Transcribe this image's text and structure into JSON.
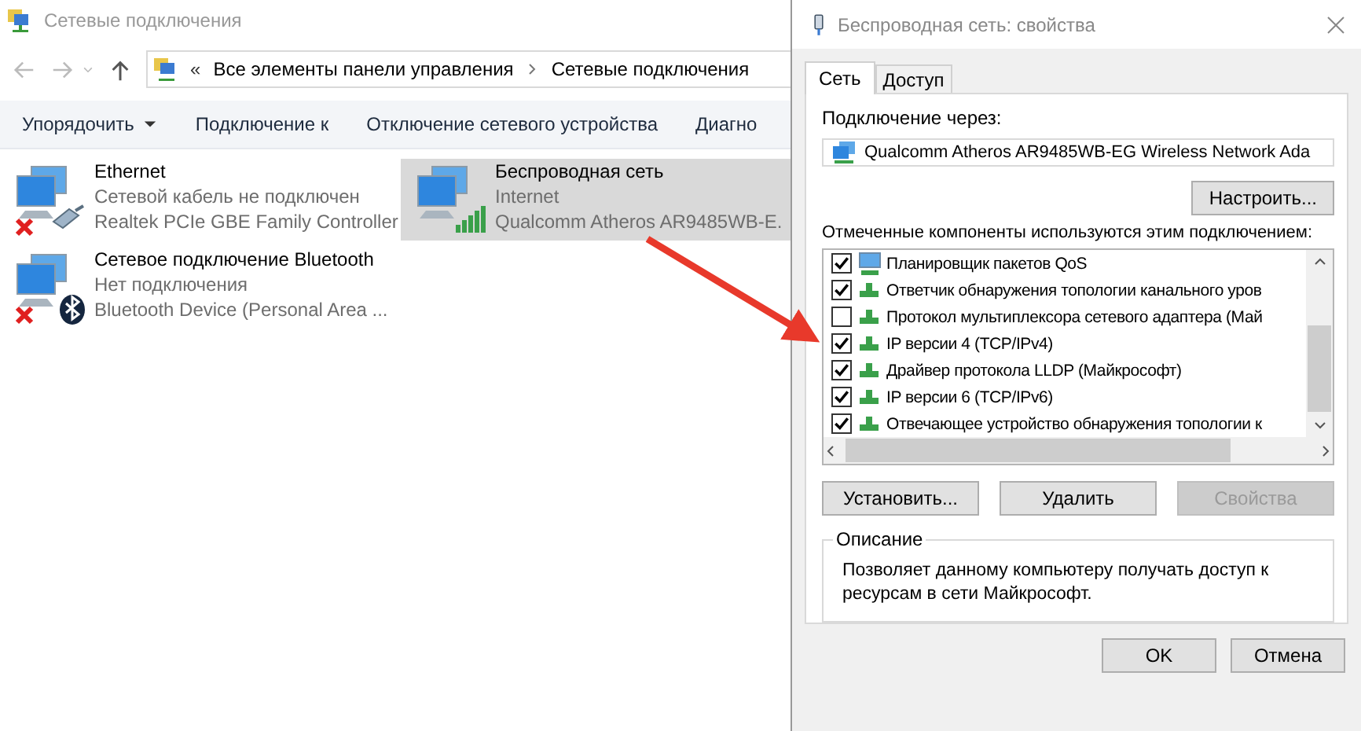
{
  "explorer": {
    "title": "Сетевые подключения",
    "breadcrumb_prefix": "«",
    "breadcrumb": [
      "Все элементы панели управления",
      "Сетевые подключения"
    ],
    "toolbar": [
      {
        "label": "Упорядочить",
        "dropdown": true
      },
      {
        "label": "Подключение к",
        "dropdown": false
      },
      {
        "label": "Отключение сетевого устройства",
        "dropdown": false
      },
      {
        "label": "Диагно",
        "dropdown": false
      }
    ],
    "connections": [
      {
        "kind": "ethernet",
        "name": "Ethernet",
        "status": "Сетевой кабель не подключен",
        "device": "Realtek PCIe GBE Family Controller",
        "disconnected": true,
        "selected": false
      },
      {
        "kind": "wifi",
        "name": "Беспроводная сеть",
        "status": "Internet",
        "device": "Qualcomm Atheros AR9485WB-E.",
        "disconnected": false,
        "selected": true
      },
      {
        "kind": "bluetooth",
        "name": "Сетевое подключение Bluetooth",
        "status": "Нет подключения",
        "device": "Bluetooth Device (Personal Area ...",
        "disconnected": true,
        "selected": false
      }
    ]
  },
  "dialog": {
    "title": "Беспроводная сеть: свойства",
    "tabs": [
      {
        "label": "Сеть",
        "selected": true
      },
      {
        "label": "Доступ",
        "selected": false
      }
    ],
    "connect_via_label": "Подключение через:",
    "adapter": "Qualcomm Atheros AR9485WB-EG Wireless Network Ada",
    "configure_button": "Настроить...",
    "components_label": "Отмеченные компоненты используются этим подключением:",
    "components": [
      {
        "kind": "service",
        "label": "Планировщик пакетов QoS",
        "checked": true
      },
      {
        "kind": "protocol",
        "label": "Ответчик обнаружения топологии канального уров",
        "checked": true
      },
      {
        "kind": "protocol",
        "label": "Протокол мультиплексора сетевого адаптера (Май",
        "checked": false
      },
      {
        "kind": "protocol",
        "label": "IP версии 4 (TCP/IPv4)",
        "checked": true
      },
      {
        "kind": "protocol",
        "label": "Драйвер протокола LLDP (Майкрософт)",
        "checked": true
      },
      {
        "kind": "protocol",
        "label": "IP версии 6 (TCP/IPv6)",
        "checked": true
      },
      {
        "kind": "protocol",
        "label": "Отвечающее устройство обнаружения топологии к",
        "checked": true
      }
    ],
    "buttons": [
      {
        "label": "Установить...",
        "disabled": false
      },
      {
        "label": "Удалить",
        "disabled": false
      },
      {
        "label": "Свойства",
        "disabled": true
      }
    ],
    "description_title": "Описание",
    "description": "Позволяет данному компьютеру получать доступ к ресурсам в сети Майкрософт.",
    "footer_buttons": [
      "OK",
      "Отмена"
    ]
  }
}
